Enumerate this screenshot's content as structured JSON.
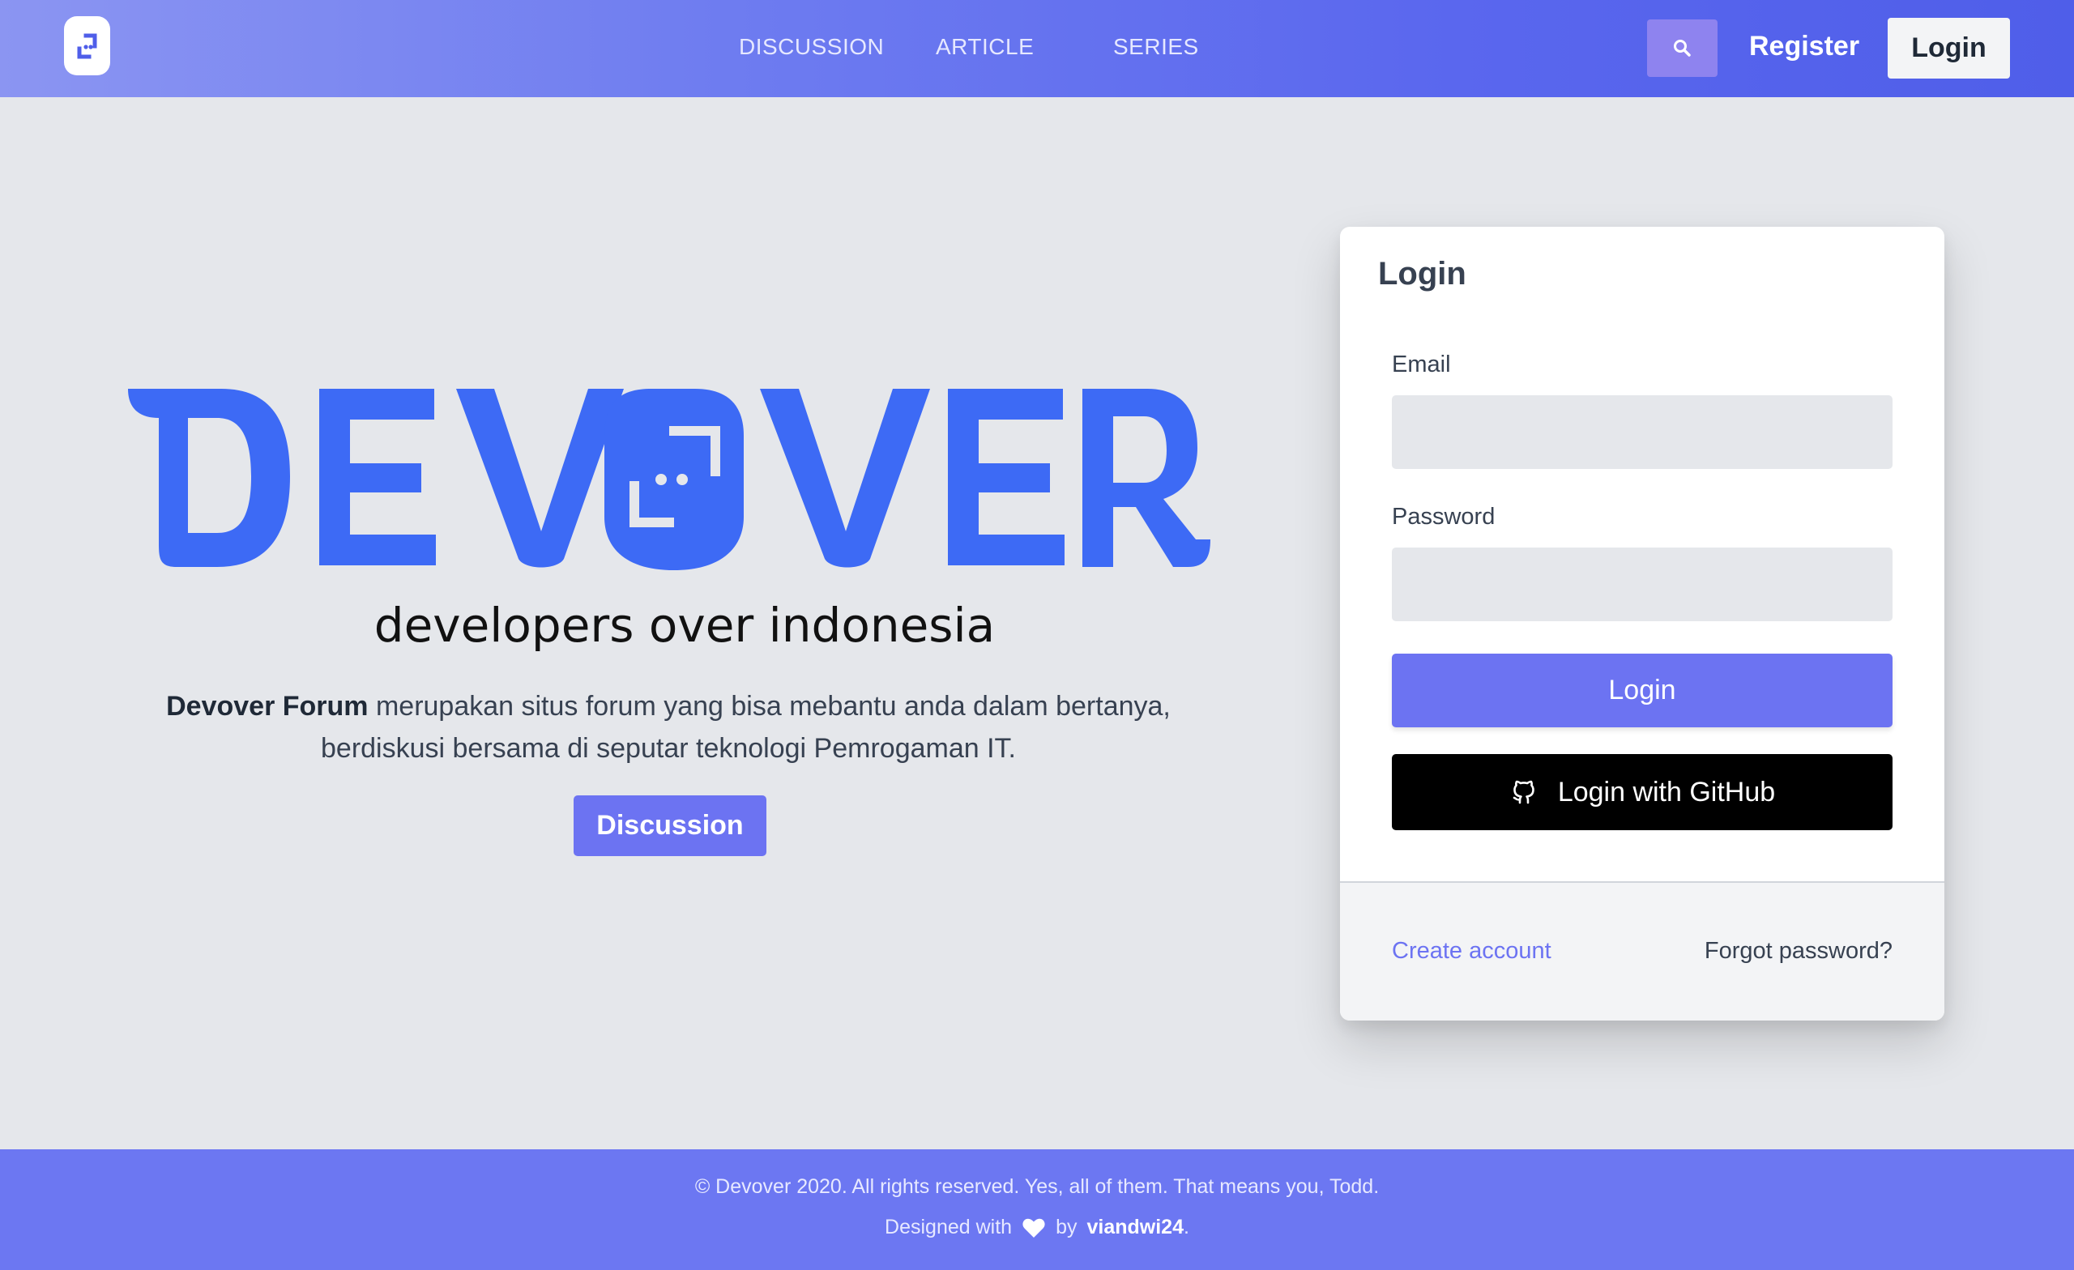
{
  "nav": {
    "links": [
      "DISCUSSION",
      "ARTICLE",
      "SERIES"
    ],
    "search_icon": "search-icon",
    "register_label": "Register",
    "login_label": "Login"
  },
  "hero": {
    "logo_text": "DEVOVER",
    "tagline": "developers over indonesia",
    "description_bold": "Devover Forum",
    "description_line1": " merupakan situs forum yang bisa mebantu anda dalam bertanya,",
    "description_line2": "berdiskusi bersama di seputar teknologi Pemrogaman IT.",
    "button_label": "Discussion"
  },
  "login_card": {
    "title": "Login",
    "email_label": "Email",
    "email_value": "",
    "password_label": "Password",
    "password_value": "",
    "login_button": "Login",
    "github_button": "Login with GitHub",
    "create_account": "Create account",
    "forgot_password": "Forgot password?"
  },
  "footer": {
    "copyright": "© Devover 2020. All rights reserved. Yes, all of them. That means you, Todd.",
    "designed_with": "Designed with",
    "by": "by",
    "author": "viandwi24",
    "period": "."
  },
  "colors": {
    "brand_blue": "#3d6af5",
    "accent_indigo": "#6c73f2",
    "github_black": "#000000"
  }
}
